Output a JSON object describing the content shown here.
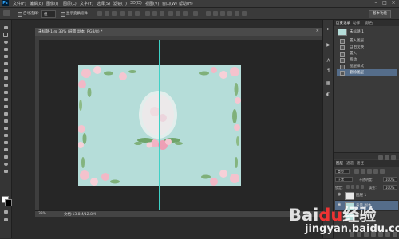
{
  "app": {
    "logo_text": "Ps"
  },
  "menu": [
    "文件(F)",
    "编辑(E)",
    "图像(I)",
    "图层(L)",
    "文字(Y)",
    "选择(S)",
    "滤镜(T)",
    "3D(D)",
    "视图(V)",
    "窗口(W)",
    "帮助(H)"
  ],
  "window_controls": [
    "–",
    "□",
    "×"
  ],
  "options_bar": {
    "auto_select_label": "自动选择：",
    "auto_select_value": "组",
    "transform_label": "显示变换控件",
    "workspace_label": "基本功能"
  },
  "document": {
    "tab_title": "未标题-1 @ 33% (背景 副本, RGB/8) *",
    "close_glyph": "×",
    "zoom": "33%",
    "doc_size": "文档:13.8M/12.8M"
  },
  "history_panel": {
    "tabs": [
      "历史记录",
      "动作",
      "颜色"
    ],
    "snapshot_label": "未标题-1",
    "items": [
      "置入图层",
      "自由变换",
      "置入",
      "移动",
      "图层样式",
      "删除图层"
    ],
    "active_index": 5
  },
  "layers_panel": {
    "tabs": [
      "图层",
      "通道",
      "路径"
    ],
    "kind_label": "类型",
    "blend_mode": "正常",
    "opacity_label": "不透明度：",
    "opacity_value": "100%",
    "lock_label": "锁定：",
    "fill_label": "填充：",
    "fill_value": "100%",
    "layers": [
      {
        "name": "图层 1",
        "thumb": "white"
      },
      {
        "name": "背景 副本",
        "thumb": "teal",
        "active": true
      },
      {
        "name": "背景",
        "thumb": "teal"
      }
    ]
  },
  "right_strip_icons": [
    "history-icon",
    "actions-icon",
    "character-icon",
    "paragraph-icon",
    "swatches-icon",
    "adjustments-icon"
  ],
  "colors": {
    "artboard": "#b5ddd9",
    "guide": "#3fd1c6",
    "selection": "#556d8a",
    "foreground": "#ffffff",
    "background": "#000000"
  },
  "watermark": {
    "logo_main": "Bai",
    "logo_mid": "du",
    "logo_tail": "经验",
    "url": "jingyan.baidu.com"
  }
}
